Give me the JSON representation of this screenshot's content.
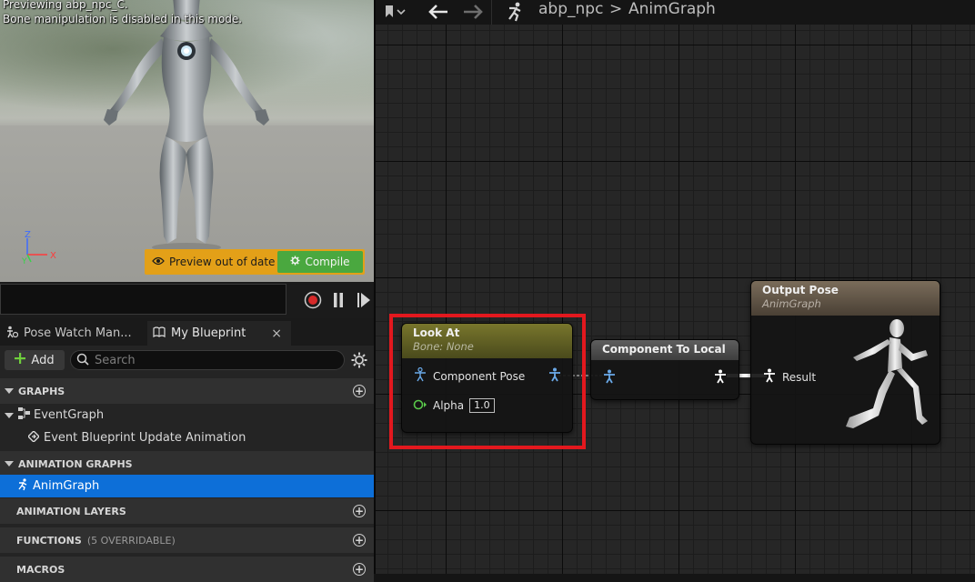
{
  "viewport": {
    "preview_line1": "Previewing abp_npc_C.",
    "preview_line2": "Bone manipulation is disabled in this mode.",
    "axis_z": "Z",
    "axis_x": "X",
    "axis_y": "Y",
    "preview_out_of_date": "Preview out of date",
    "compile_label": "Compile",
    "colors": {
      "banner": "#e3a018",
      "compile": "#4aa83f"
    }
  },
  "timeline": {
    "record_icon": "record-icon",
    "pause_icon": "pause-icon",
    "play_icon": "play-icon"
  },
  "tabs": [
    {
      "label": "Pose Watch Man...",
      "icon": "pose-watch-icon"
    },
    {
      "label": "My Blueprint",
      "icon": "book-icon",
      "close": "×"
    }
  ],
  "toolbar": {
    "add_label": "Add",
    "search_placeholder": "Search"
  },
  "tree": {
    "graphs": "GRAPHS",
    "event_graph": "EventGraph",
    "event_update": "Event Blueprint Update Animation",
    "animation_graphs": "ANIMATION GRAPHS",
    "anim_graph": "AnimGraph",
    "animation_layers": "ANIMATION LAYERS",
    "functions": "FUNCTIONS",
    "functions_sub": "(5 OVERRIDABLE)",
    "macros": "MACROS"
  },
  "graph_header": {
    "crumb_root": "abp_npc",
    "separator": ">",
    "crumb_current": "AnimGraph"
  },
  "nodes": {
    "look_at": {
      "title": "Look At",
      "subtitle": "Bone: None",
      "pin_pose": "Component Pose",
      "pin_alpha": "Alpha",
      "alpha_value": "1.0"
    },
    "component_to_local": {
      "title": "Component To Local"
    },
    "output_pose": {
      "title": "Output Pose",
      "subtitle": "AnimGraph",
      "pin_result": "Result"
    }
  },
  "accent": {
    "selection": "#0d6fd8",
    "highlight": "#e3181e"
  }
}
